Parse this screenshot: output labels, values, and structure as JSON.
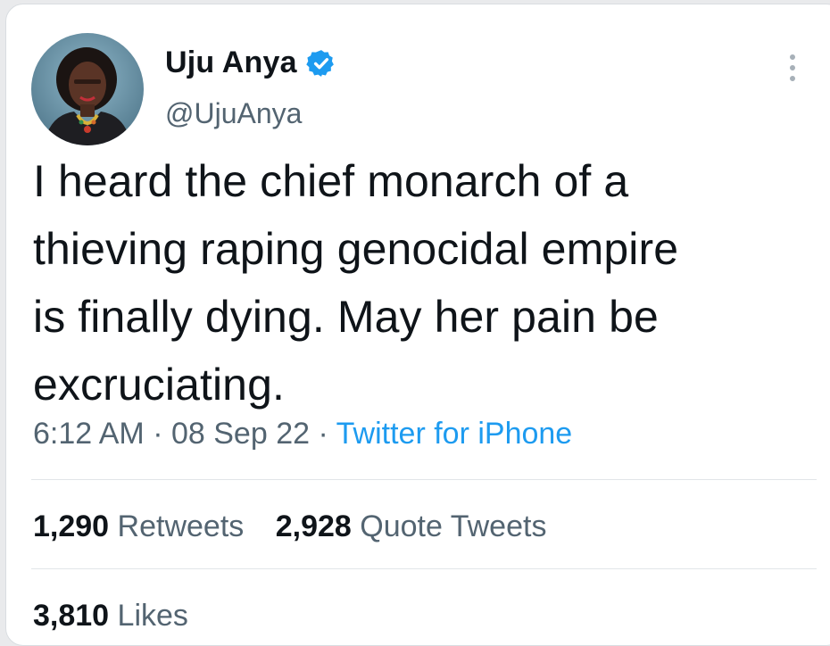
{
  "author": {
    "name": "Uju Anya",
    "handle": "@UjuAnya",
    "verified": true,
    "avatar_icon": "profile-photo-avatar",
    "verified_icon": "verified-badge-icon"
  },
  "tweet": {
    "text_lines": [
      "I heard the chief monarch of a",
      "thieving raping genocidal empire",
      "is finally dying. May her pain be",
      "excruciating."
    ],
    "time": "6:12 AM",
    "date": "08 Sep 22",
    "separator": "·",
    "source": "Twitter for iPhone"
  },
  "stats": {
    "retweets_count": "1,290",
    "retweets_label": "Retweets",
    "quotes_count": "2,928",
    "quotes_label": "Quote Tweets",
    "likes_count": "3,810",
    "likes_label": "Likes"
  },
  "colors": {
    "text": "#0f1419",
    "secondary": "#536471",
    "link": "#1d9bf0",
    "verified": "#1d9bf0"
  },
  "icons": {
    "more": "more-options-icon"
  }
}
